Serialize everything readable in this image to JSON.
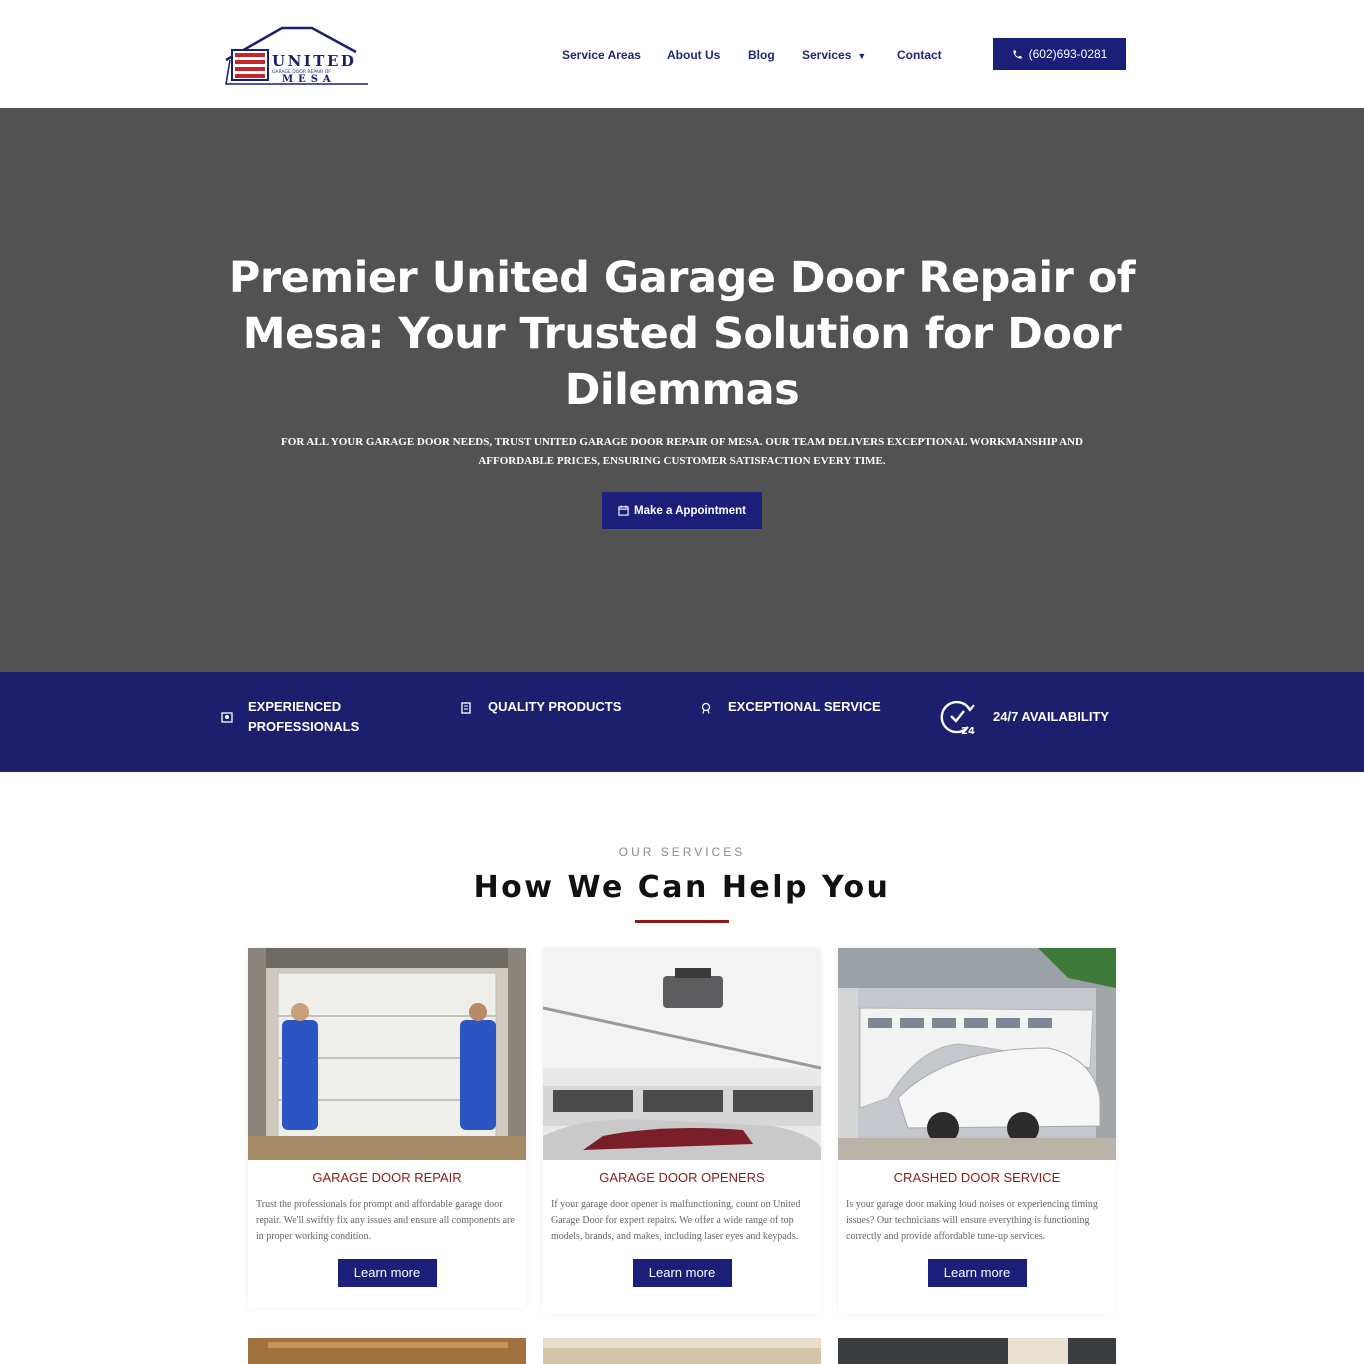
{
  "header": {
    "logo": {
      "word": "UNITED",
      "tagline": "GARAGE DOOR REPAIR OF",
      "city": "MESA"
    },
    "nav": [
      {
        "label": "Service Areas"
      },
      {
        "label": "About Us"
      },
      {
        "label": "Blog"
      },
      {
        "label": "Services",
        "has_dropdown": true
      },
      {
        "label": "Contact"
      }
    ],
    "phone": "(602)693-0281"
  },
  "hero": {
    "title": "Premier United Garage Door Repair of Mesa: Your Trusted Solution for Door Dilemmas",
    "subtitle": "FOR ALL YOUR GARAGE DOOR NEEDS, TRUST UNITED GARAGE DOOR REPAIR OF MESA. OUR TEAM DELIVERS EXCEPTIONAL WORKMANSHIP AND AFFORDABLE PRICES, ENSURING CUSTOMER SATISFACTION EVERY TIME.",
    "cta": "Make a Appointment"
  },
  "features": [
    {
      "label": "EXPERIENCED PROFESSIONALS",
      "icon": "users-icon"
    },
    {
      "label": "QUALITY PRODUCTS",
      "icon": "badge-icon"
    },
    {
      "label": "EXCEPTIONAL SERVICE",
      "icon": "medal-icon"
    },
    {
      "label": "24/7 AVAILABILITY",
      "icon": "clock-24-icon"
    }
  ],
  "services": {
    "eyebrow": "OUR SERVICES",
    "title": "How We Can Help You",
    "cards": [
      {
        "title": "GARAGE DOOR REPAIR",
        "text": "Trust the professionals for prompt and affordable garage door repair. We'll swiftly fix any issues and ensure all components are in proper working condition.",
        "button": "Learn more"
      },
      {
        "title": "GARAGE DOOR OPENERS",
        "text": "If your garage door opener is malfunctioning, count on United Garage Door for expert repairs. We offer a wide range of top models, brands, and makes, including laser eyes and keypads.",
        "button": "Learn more"
      },
      {
        "title": "CRASHED DOOR SERVICE",
        "text": "Is your garage door making loud noises or experiencing timing issues? Our technicians will ensure everything is functioning correctly and provide affordable tune-up services.",
        "button": "Learn more"
      }
    ]
  },
  "colors": {
    "navy": "#1c1f7a",
    "band": "#1c1f6e",
    "hero_bg": "#525252",
    "accent_red": "#8c1c1c"
  }
}
